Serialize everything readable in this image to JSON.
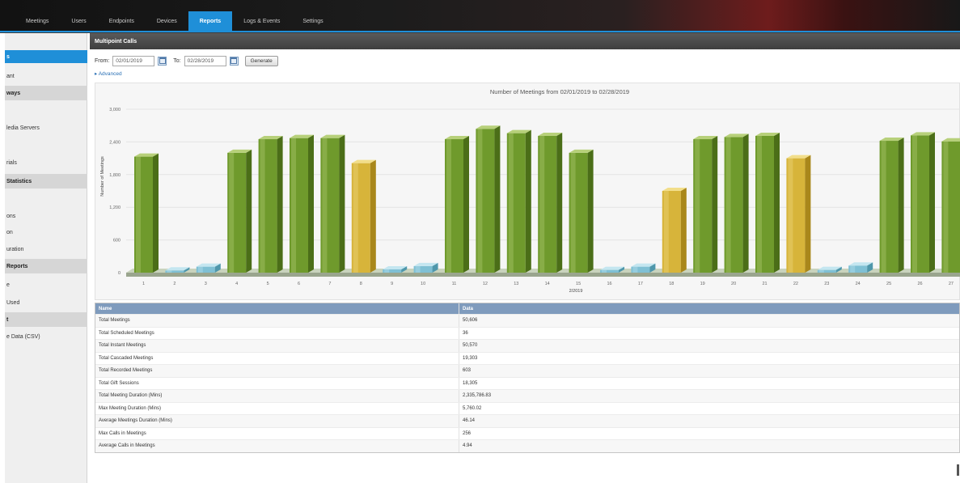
{
  "nav": {
    "tabs": [
      {
        "label": "Meetings"
      },
      {
        "label": "Users"
      },
      {
        "label": "Endpoints"
      },
      {
        "label": "Devices"
      },
      {
        "label": "Reports",
        "active": true
      },
      {
        "label": "Logs & Events"
      },
      {
        "label": "Settings"
      }
    ]
  },
  "sidebar": {
    "items": [
      {
        "label": "s",
        "selected": true
      },
      {
        "label": "ant"
      },
      {
        "label": "ways",
        "header": true
      },
      {
        "label": "ledia Servers"
      },
      {
        "label": "rials"
      },
      {
        "label": "Statistics",
        "header": true
      },
      {
        "label": "ons"
      },
      {
        "label": "on"
      },
      {
        "label": "uration"
      },
      {
        "label": "Reports",
        "header": true
      },
      {
        "label": "e"
      },
      {
        "label": "Used"
      },
      {
        "label": "t",
        "header": true
      },
      {
        "label": "e Data (CSV)"
      }
    ]
  },
  "panel": {
    "title": "Multipoint Calls"
  },
  "filter": {
    "from_label": "From:",
    "from_value": "02/01/2019",
    "to_label": "To:",
    "to_value": "02/28/2019",
    "generate_label": "Generate",
    "advanced_label": "▸ Advanced"
  },
  "chart_data": {
    "type": "bar",
    "title": "Number of Meetings from 02/01/2019 to 02/28/2019",
    "xlabel": "2/2019",
    "ylabel": "Number of Meetings",
    "ylim": [
      0,
      3000
    ],
    "yticks": [
      0,
      600,
      1200,
      1800,
      2400,
      3000
    ],
    "ytick_labels": [
      "0",
      "600",
      "1,200",
      "1,800",
      "2,400",
      "3,000"
    ],
    "categories": [
      "1",
      "2",
      "3",
      "4",
      "5",
      "6",
      "7",
      "8",
      "9",
      "10",
      "11",
      "12",
      "13",
      "14",
      "15",
      "16",
      "17",
      "18",
      "19",
      "20",
      "21",
      "22",
      "23",
      "24",
      "25",
      "26",
      "27"
    ],
    "values": [
      2130,
      40,
      110,
      2200,
      2450,
      2470,
      2470,
      2010,
      60,
      120,
      2450,
      2640,
      2560,
      2510,
      2200,
      50,
      110,
      1500,
      2450,
      2490,
      2510,
      2100,
      50,
      130,
      2420,
      2520,
      2410
    ],
    "bar_colors": {
      "weekday": "#7ea43a",
      "low": "#7fc0d4",
      "highlight": "#d7b43a"
    },
    "bar_kinds": [
      "weekday",
      "low",
      "low",
      "weekday",
      "weekday",
      "weekday",
      "weekday",
      "highlight",
      "low",
      "low",
      "weekday",
      "weekday",
      "weekday",
      "weekday",
      "weekday",
      "low",
      "low",
      "highlight",
      "weekday",
      "weekday",
      "weekday",
      "highlight",
      "low",
      "low",
      "weekday",
      "weekday",
      "weekday"
    ],
    "grid": true
  },
  "table": {
    "headers": [
      "Name",
      "Data"
    ],
    "rows": [
      [
        "Total Meetings",
        "50,606"
      ],
      [
        "Total Scheduled Meetings",
        "36"
      ],
      [
        "Total Instant Meetings",
        "50,570"
      ],
      [
        "Total Cascaded Meetings",
        "19,303"
      ],
      [
        "Total Recorded Meetings",
        "603"
      ],
      [
        "Total Gift Sessions",
        "18,305"
      ],
      [
        "Total Meeting Duration (Mins)",
        "2,335,786.83"
      ],
      [
        "Max Meeting Duration (Mins)",
        "5,760.02"
      ],
      [
        "Average Meetings Duration (Mins)",
        "46.14"
      ],
      [
        "Max Calls in Meetings",
        "256"
      ],
      [
        "Average Calls in Meetings",
        "4.94"
      ]
    ]
  }
}
